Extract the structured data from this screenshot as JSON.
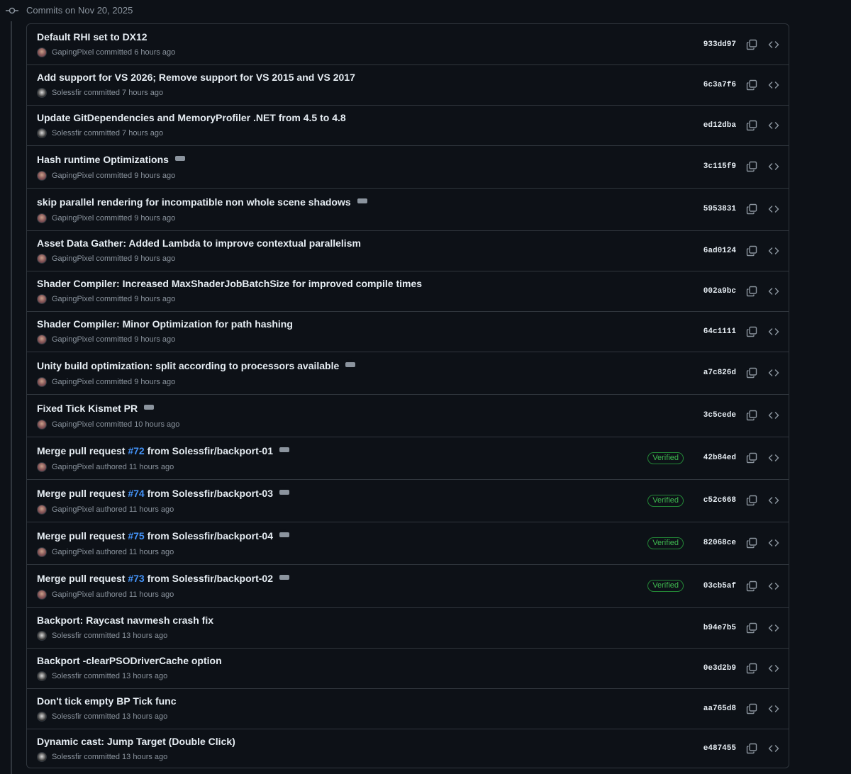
{
  "header": {
    "title": "Commits on Nov 20, 2025"
  },
  "commits": [
    {
      "message": "Default RHI set to DX12",
      "author": "GapingPixel",
      "action": "committed",
      "time": "6 hours ago",
      "sha": "933dd97",
      "avatar": "gp",
      "ellipsis": false,
      "verified": null
    },
    {
      "message": "Add support for VS 2026; Remove support for VS 2015 and VS 2017",
      "author": "Solessfir",
      "action": "committed",
      "time": "7 hours ago",
      "sha": "6c3a7f6",
      "avatar": "so",
      "ellipsis": false,
      "verified": null
    },
    {
      "message": "Update GitDependencies and MemoryProfiler .NET from 4.5 to 4.8",
      "author": "Solessfir",
      "action": "committed",
      "time": "7 hours ago",
      "sha": "ed12dba",
      "avatar": "so",
      "ellipsis": false,
      "verified": null
    },
    {
      "message": "Hash runtime Optimizations",
      "author": "GapingPixel",
      "action": "committed",
      "time": "9 hours ago",
      "sha": "3c115f9",
      "avatar": "gp",
      "ellipsis": true,
      "verified": null
    },
    {
      "message": "skip parallel rendering for incompatible non whole scene shadows",
      "author": "GapingPixel",
      "action": "committed",
      "time": "9 hours ago",
      "sha": "5953831",
      "avatar": "gp",
      "ellipsis": true,
      "verified": null
    },
    {
      "message": "Asset Data Gather: Added Lambda to improve contextual parallelism",
      "author": "GapingPixel",
      "action": "committed",
      "time": "9 hours ago",
      "sha": "6ad0124",
      "avatar": "gp",
      "ellipsis": false,
      "verified": null
    },
    {
      "message": "Shader Compiler: Increased MaxShaderJobBatchSize for improved compile times",
      "author": "GapingPixel",
      "action": "committed",
      "time": "9 hours ago",
      "sha": "002a9bc",
      "avatar": "gp",
      "ellipsis": false,
      "verified": null
    },
    {
      "message": "Shader Compiler: Minor Optimization for path hashing",
      "author": "GapingPixel",
      "action": "committed",
      "time": "9 hours ago",
      "sha": "64c1111",
      "avatar": "gp",
      "ellipsis": false,
      "verified": null
    },
    {
      "message": "Unity build optimization: split according to processors available",
      "author": "GapingPixel",
      "action": "committed",
      "time": "9 hours ago",
      "sha": "a7c826d",
      "avatar": "gp",
      "ellipsis": true,
      "verified": null
    },
    {
      "message": "Fixed Tick Kismet PR",
      "author": "GapingPixel",
      "action": "committed",
      "time": "10 hours ago",
      "sha": "3c5cede",
      "avatar": "gp",
      "ellipsis": true,
      "verified": null
    },
    {
      "message_pre": "Merge pull request ",
      "pr": "#72",
      "message_post": " from Solessfir/backport-01",
      "author": "GapingPixel",
      "action": "authored",
      "time": "11 hours ago",
      "sha": "42b84ed",
      "avatar": "gp",
      "ellipsis": true,
      "verified": "Verified"
    },
    {
      "message_pre": "Merge pull request ",
      "pr": "#74",
      "message_post": " from Solessfir/backport-03",
      "author": "GapingPixel",
      "action": "authored",
      "time": "11 hours ago",
      "sha": "c52c668",
      "avatar": "gp",
      "ellipsis": true,
      "verified": "Verified"
    },
    {
      "message_pre": "Merge pull request ",
      "pr": "#75",
      "message_post": " from Solessfir/backport-04",
      "author": "GapingPixel",
      "action": "authored",
      "time": "11 hours ago",
      "sha": "82068ce",
      "avatar": "gp",
      "ellipsis": true,
      "verified": "Verified"
    },
    {
      "message_pre": "Merge pull request ",
      "pr": "#73",
      "message_post": " from Solessfir/backport-02",
      "author": "GapingPixel",
      "action": "authored",
      "time": "11 hours ago",
      "sha": "03cb5af",
      "avatar": "gp",
      "ellipsis": true,
      "verified": "Verified"
    },
    {
      "message": "Backport: Raycast navmesh crash fix",
      "author": "Solessfir",
      "action": "committed",
      "time": "13 hours ago",
      "sha": "b94e7b5",
      "avatar": "so",
      "ellipsis": false,
      "verified": null
    },
    {
      "message": "Backport -clearPSODriverCache option",
      "author": "Solessfir",
      "action": "committed",
      "time": "13 hours ago",
      "sha": "0e3d2b9",
      "avatar": "so",
      "ellipsis": false,
      "verified": null
    },
    {
      "message": "Don't tick empty BP Tick func",
      "author": "Solessfir",
      "action": "committed",
      "time": "13 hours ago",
      "sha": "aa765d8",
      "avatar": "so",
      "ellipsis": false,
      "verified": null
    },
    {
      "message": "Dynamic cast: Jump Target (Double Click)",
      "author": "Solessfir",
      "action": "committed",
      "time": "13 hours ago",
      "sha": "e487455",
      "avatar": "so",
      "ellipsis": false,
      "verified": null
    }
  ]
}
